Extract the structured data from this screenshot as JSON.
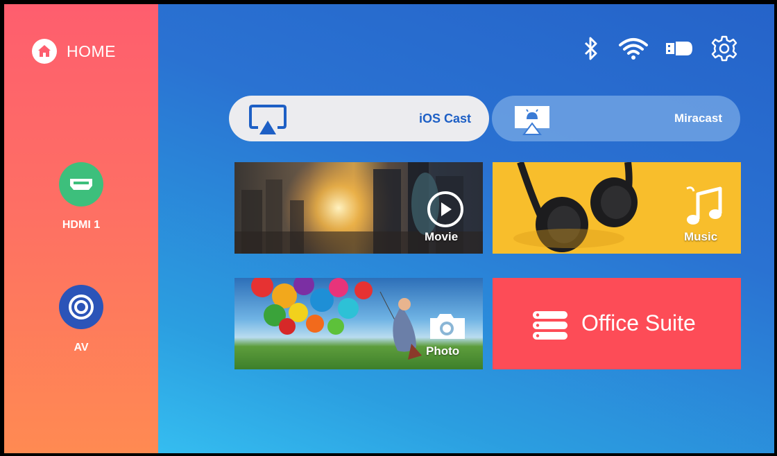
{
  "sidebar": {
    "home_label": "HOME",
    "sources": [
      {
        "label": "HDMI 1",
        "icon": "hdmi-icon",
        "color": "#3dbf7c"
      },
      {
        "label": "AV",
        "icon": "av-icon",
        "color": "#2b54b8"
      }
    ]
  },
  "status_bar": {
    "icons": [
      "bluetooth-icon",
      "wifi-icon",
      "usb-drive-icon",
      "settings-gear-icon"
    ]
  },
  "cast": {
    "ios_label": "iOS Cast",
    "miracast_label": "Miracast"
  },
  "tiles": {
    "movie_label": "Movie",
    "music_label": "Music",
    "photo_label": "Photo",
    "office_label": "Office Suite"
  },
  "colors": {
    "sidebar_top": "#fe5e6e",
    "sidebar_bottom": "#ff8a52",
    "main_top": "#2563c9",
    "main_bottom": "#35bdf0",
    "ios_text": "#1d5fc5",
    "music_tile": "#f8be2c",
    "office_tile": "#fd4c57"
  }
}
